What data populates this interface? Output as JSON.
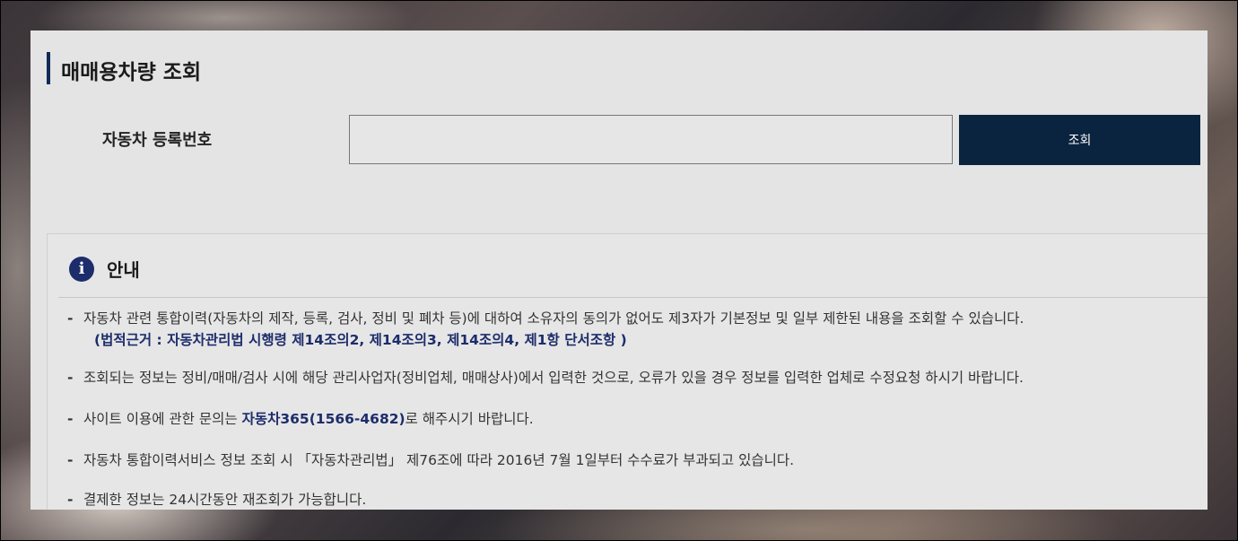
{
  "page": {
    "title": "매매용차량 조회"
  },
  "search": {
    "label": "자동차 등록번호",
    "input_value": "",
    "button_label": "조회"
  },
  "notice": {
    "icon": "info-icon",
    "icon_glyph": "i",
    "title": "안내",
    "items": [
      {
        "text": "자동차 관련 통합이력(자동차의 제작, 등록, 검사, 정비 및 폐차 등)에 대하여 소유자의 동의가 없어도 제3자가 기본정보 및 일부 제한된 내용을 조회할 수 있습니다.",
        "law_ref": "(법적근거 : 자동차관리법 시행령 제14조의2, 제14조의3, 제14조의4, 제1항 단서조항 )"
      },
      {
        "text": "조회되는 정보는 정비/매매/검사 시에 해당 관리사업자(정비업체, 매매상사)에서 입력한 것으로, 오류가 있을 경우 정보를 입력한 업체로 수정요청 하시기 바랍니다."
      },
      {
        "prefix": "사이트 이용에 관한 문의는 ",
        "highlight": "자동차365(1566-4682)",
        "suffix": "로 해주시기 바랍니다."
      },
      {
        "text": "자동차 통합이력서비스 정보 조회 시 「자동차관리법」 제76조에 따라 2016년 7월 1일부터 수수료가 부과되고 있습니다."
      },
      {
        "text": "결제한 정보는 24시간동안 재조회가 가능합니다."
      }
    ]
  },
  "colors": {
    "accent": "#0f2a57",
    "button_bg": "#0a2440",
    "highlight": "#1d2d6b",
    "panel_bg": "#e4e4e4"
  }
}
